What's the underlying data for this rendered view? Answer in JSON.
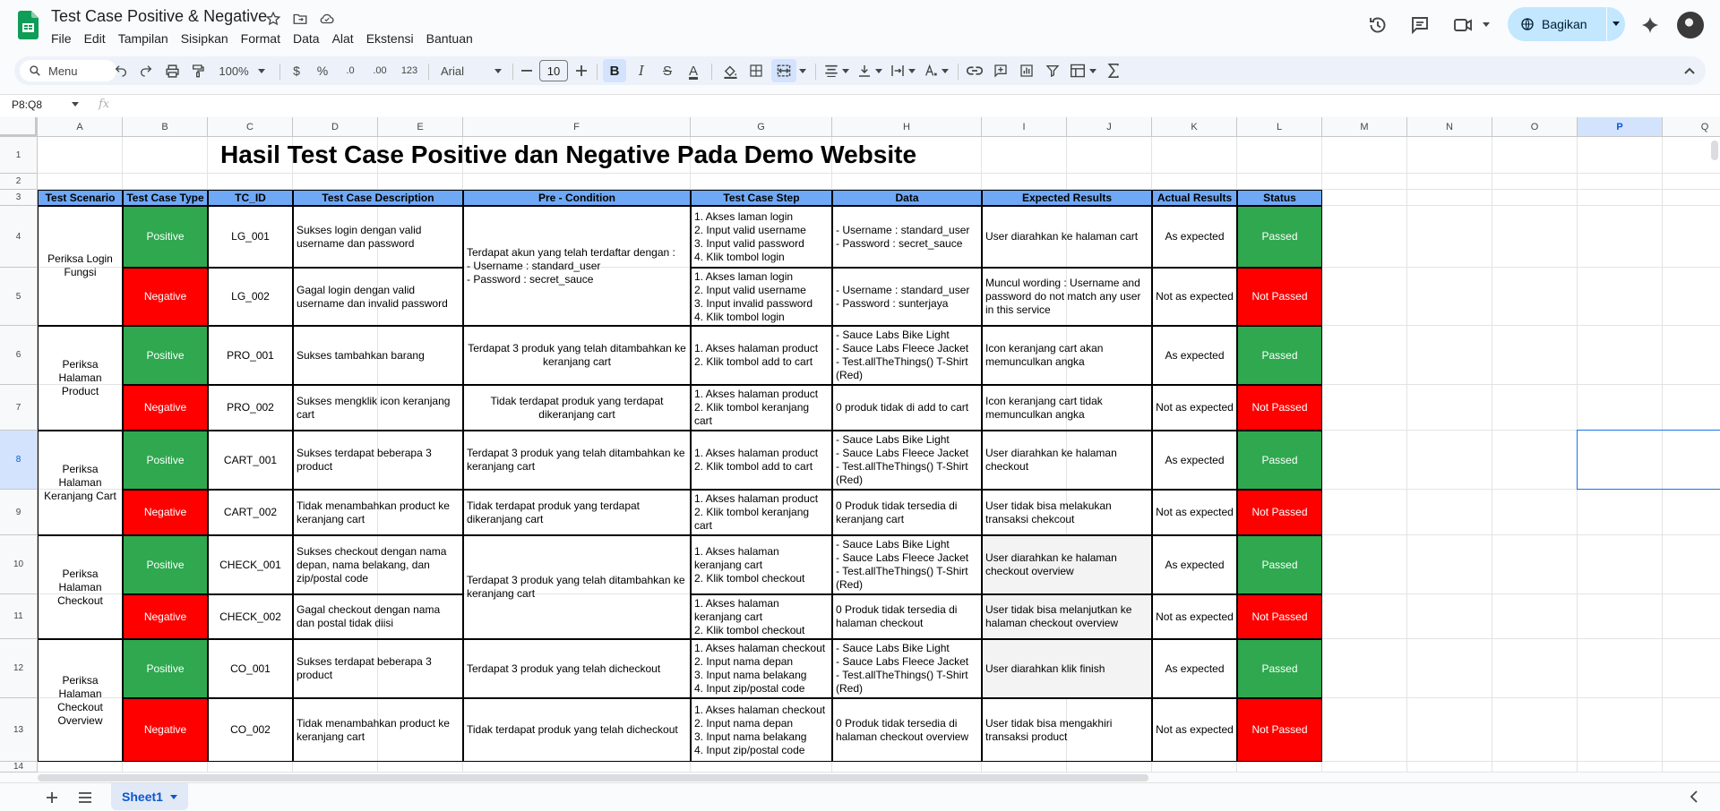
{
  "app": {
    "doc_title": "Test Case Positive & Negative",
    "share_label": "Bagikan"
  },
  "menu": [
    "File",
    "Edit",
    "Tampilan",
    "Sisipkan",
    "Format",
    "Data",
    "Alat",
    "Ekstensi",
    "Bantuan"
  ],
  "toolbar": {
    "menu_search": "Menu",
    "zoom": "100%",
    "currency": "$",
    "percent": "%",
    "dec_decrease": ".0",
    "dec_increase": ".00",
    "number_format": "123",
    "font": "Arial",
    "font_size": "10",
    "bold": "B",
    "italic": "I",
    "strike": "S",
    "text_color": "A"
  },
  "formula_bar": {
    "name_box": "P8:Q8",
    "fx": "fx"
  },
  "columns": [
    "A",
    "B",
    "C",
    "D",
    "E",
    "F",
    "G",
    "H",
    "I",
    "J",
    "K",
    "L",
    "M",
    "N",
    "O",
    "P",
    "Q"
  ],
  "rows": [
    "1",
    "2",
    "3",
    "4",
    "5",
    "6",
    "7",
    "8",
    "9",
    "10",
    "11",
    "12",
    "13",
    "14"
  ],
  "sheet": {
    "title": "Hasil Test Case Positive dan Negative Pada Demo Website",
    "headers": [
      "Test Scenario",
      "Test Case Type",
      "TC_ID",
      "Test Case Description",
      "Pre - Condition",
      "Test Case Step",
      "Data",
      "Expected Results",
      "Actual Results",
      "Status"
    ],
    "scenarios": [
      "Periksa Login Fungsi",
      "Periksa Halaman Product",
      "Periksa Halaman Keranjang Cart",
      "Periksa Halaman Checkout",
      "Periksa Halaman Checkout Overview"
    ],
    "preconditions": [
      "Terdapat akun yang telah terdaftar dengan :\n- Username : standard_user\n- Password : secret_sauce",
      "Terdapat 3 produk yang telah ditambahkan ke keranjang cart",
      "Tidak terdapat produk yang terdapat dikeranjang cart",
      "Terdapat 3 produk yang telah ditambahkan ke keranjang cart",
      "Tidak terdapat produk yang terdapat dikeranjang cart",
      "Terdapat 3 produk yang telah ditambahkan ke keranjang cart",
      "Terdapat 3 produk yang telah dicheckout",
      "Tidak terdapat produk yang telah dicheckout"
    ],
    "test_rows": [
      {
        "type": "Positive",
        "id": "LG_001",
        "desc": "Sukses login dengan valid username dan password",
        "steps": "1. Akses laman login\n2. Input valid username\n3. Input valid password\n4. Klik tombol login",
        "data": "- Username : standard_user\n- Password : secret_sauce",
        "expected": "User diarahkan ke halaman cart",
        "actual": "As expected",
        "status": "Passed"
      },
      {
        "type": "Negative",
        "id": "LG_002",
        "desc": "Gagal login dengan valid username dan invalid password",
        "steps": "1. Akses laman login\n2. Input valid username\n3. Input invalid password\n4. Klik tombol login",
        "data": "- Username : standard_user\n- Password : sunterjaya",
        "expected": "Muncul wording : Username and password do not match any user in this service",
        "actual": "Not as expected",
        "status": "Not Passed"
      },
      {
        "type": "Positive",
        "id": "PRO_001",
        "desc": "Sukses tambahkan barang",
        "steps": "1. Akses halaman product\n2. Klik tombol add to cart",
        "data": "- Sauce Labs Bike Light\n- Sauce Labs Fleece Jacket\n- Test.allTheThings() T-Shirt (Red)",
        "expected": "Icon keranjang cart akan memunculkan angka",
        "actual": "As expected",
        "status": "Passed"
      },
      {
        "type": "Negative",
        "id": "PRO_002",
        "desc": "Sukses mengklik icon keranjang cart",
        "steps": "1. Akses halaman product\n2. Klik tombol keranjang cart",
        "data": "0 produk tidak di add to cart",
        "expected": "Icon keranjang cart tidak memunculkan angka",
        "actual": "Not as expected",
        "status": "Not Passed"
      },
      {
        "type": "Positive",
        "id": "CART_001",
        "desc": "Sukses terdapat beberapa 3 product",
        "steps": "1. Akses halaman product\n2. Klik tombol add to cart",
        "data": "- Sauce Labs Bike Light\n- Sauce Labs Fleece Jacket\n- Test.allTheThings() T-Shirt (Red)",
        "expected": "User diarahkan ke halaman checkout",
        "actual": "As expected",
        "status": "Passed"
      },
      {
        "type": "Negative",
        "id": "CART_002",
        "desc": "Tidak menambahkan product ke keranjang cart",
        "steps": "1. Akses halaman product\n2. Klik tombol keranjang cart",
        "data": "0 Produk tidak tersedia di keranjang cart",
        "expected": "User tidak bisa melakukan transaksi chekcout",
        "actual": "Not as expected",
        "status": "Not Passed"
      },
      {
        "type": "Positive",
        "id": "CHECK_001",
        "desc": "Sukses checkout dengan nama depan, nama belakang, dan zip/postal code",
        "steps": "1. Akses halaman keranjang cart\n2. Klik tombol checkout",
        "data": "- Sauce Labs Bike Light\n- Sauce Labs Fleece Jacket\n- Test.allTheThings() T-Shirt (Red)",
        "expected": "User diarahkan ke halaman checkout overview",
        "actual": "As expected",
        "status": "Passed"
      },
      {
        "type": "Negative",
        "id": "CHECK_002",
        "desc": "Gagal checkout dengan nama dan postal tidak diisi",
        "steps": "1. Akses halaman keranjang cart\n2. Klik tombol checkout",
        "data": "0 Produk tidak tersedia di halaman checkout",
        "expected": "User tidak bisa melanjutkan ke halaman checkout overview",
        "actual": "Not as expected",
        "status": "Not Passed"
      },
      {
        "type": "Positive",
        "id": "CO_001",
        "desc": "Sukses terdapat beberapa 3 product",
        "steps": "1. Akses halaman checkout\n2. Input nama depan\n3. Input nama belakang\n4. Input zip/postal code",
        "data": "- Sauce Labs Bike Light\n- Sauce Labs Fleece Jacket\n- Test.allTheThings() T-Shirt (Red)",
        "expected": "User diarahkan klik finish",
        "actual": "As expected",
        "status": "Passed"
      },
      {
        "type": "Negative",
        "id": "CO_002",
        "desc": "Tidak menambahkan product ke keranjang cart",
        "steps": "1. Akses halaman checkout\n2. Input nama depan\n3. Input nama belakang\n4. Input zip/postal code",
        "data": "0 Produk tidak tersedia di halaman checkout overview",
        "expected": "User tidak bisa mengakhiri transaksi product",
        "actual": "Not as expected",
        "status": "Not Passed"
      }
    ]
  },
  "bottom": {
    "sheet_tab": "Sheet1"
  },
  "colors": {
    "header_blue": "#6fa8f5",
    "positive_green": "#2fa84f",
    "negative_red": "#ff0000",
    "accent": "#0b57d0",
    "share_bg": "#c2e7ff"
  }
}
